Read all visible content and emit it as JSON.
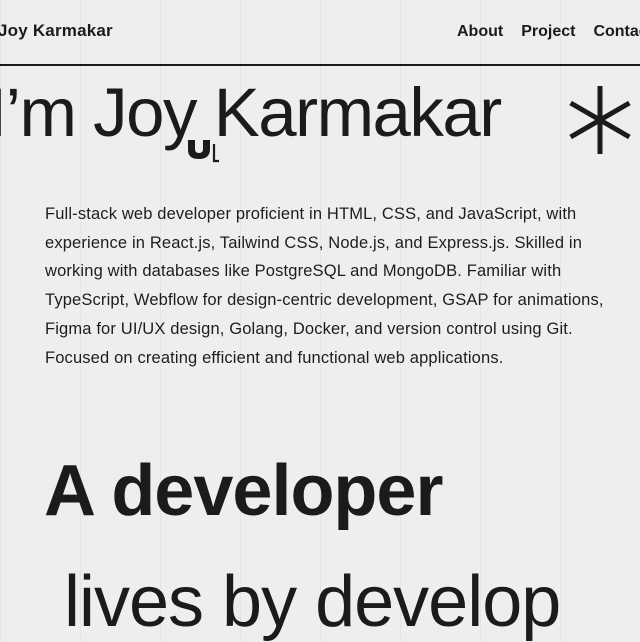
{
  "nav": {
    "brand": "Joy Karmakar",
    "links": [
      "About",
      "Project",
      "Contact"
    ]
  },
  "hero": {
    "title": "I’m Joy Karmakar"
  },
  "bio": "Full-stack web developer proficient in HTML, CSS, and JavaScript, with experience in React.js, Tailwind CSS, Node.js, and Express.js. Skilled in working with databases like PostgreSQL and MongoDB. Familiar with TypeScript, Webflow for design-centric development, GSAP for animations, Figma for UI/UX design, Golang, Docker, and version control using Git. Focused on creating efficient and functional web applications.",
  "tagline": {
    "line1": "A developer",
    "line2": "lives by develop"
  },
  "icons": [
    "cursor-icon",
    "asterisk-icon"
  ],
  "colors": {
    "background": "#efeeec",
    "text": "#1b1b1b"
  }
}
